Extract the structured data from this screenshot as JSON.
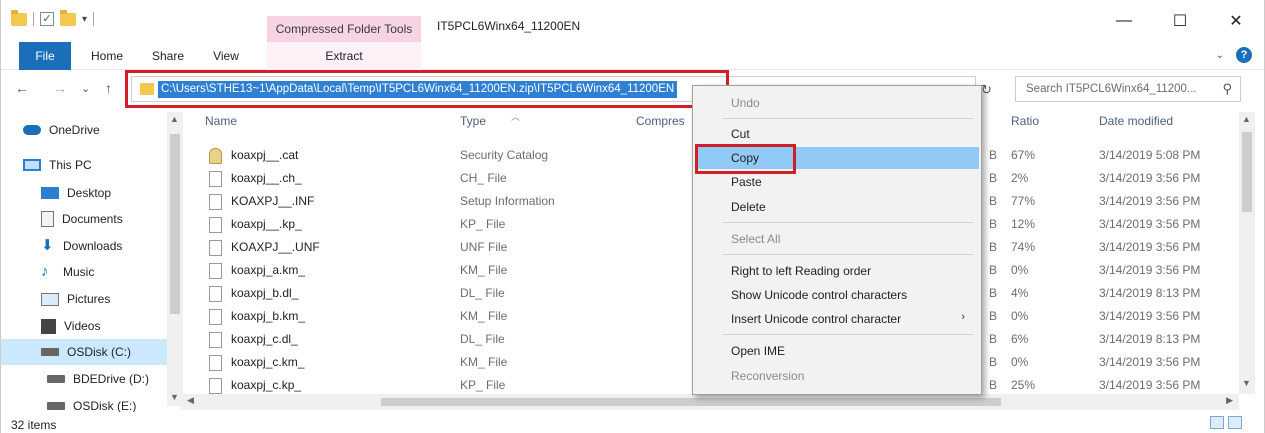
{
  "window": {
    "title": "IT5PCL6Winx64_11200EN",
    "context_tab_group": "Compressed Folder Tools",
    "controls": {
      "minimize": "—",
      "maximize": "☐",
      "close": "✕"
    }
  },
  "ribbon": {
    "tabs": [
      "File",
      "Home",
      "Share",
      "View",
      "Extract"
    ],
    "help_label": "?"
  },
  "address_bar": {
    "path": "C:\\Users\\STHE13~1\\AppData\\Local\\Temp\\IT5PCL6Winx64_11200EN.zip\\IT5PCL6Winx64_11200EN",
    "search_placeholder": "Search IT5PCL6Winx64_11200...",
    "nav": {
      "back": "←",
      "forward": "→",
      "recent": "⌄",
      "up": "↑",
      "refresh": "↻",
      "search": "⚲"
    }
  },
  "nav_pane": {
    "items": [
      {
        "label": "OneDrive",
        "icon": "onedrive-icon"
      },
      {
        "label": "This PC",
        "icon": "pc-icon"
      },
      {
        "label": "Desktop",
        "icon": "desktop-icon"
      },
      {
        "label": "Documents",
        "icon": "documents-icon"
      },
      {
        "label": "Downloads",
        "icon": "downloads-icon"
      },
      {
        "label": "Music",
        "icon": "music-icon"
      },
      {
        "label": "Pictures",
        "icon": "pictures-icon"
      },
      {
        "label": "Videos",
        "icon": "videos-icon"
      },
      {
        "label": "OSDisk (C:)",
        "icon": "drive-icon"
      },
      {
        "label": "BDEDrive (D:)",
        "icon": "drive-icon"
      },
      {
        "label": "OSDisk (E:)",
        "icon": "drive-icon"
      }
    ]
  },
  "columns": {
    "name": "Name",
    "type": "Type",
    "compressed": "Compres",
    "ratio": "Ratio",
    "date": "Date modified"
  },
  "files": [
    {
      "name": "koaxpj__.cat",
      "type": "Security Catalog",
      "ratio": "67%",
      "date": "3/14/2019 5:08 PM"
    },
    {
      "name": "koaxpj__.ch_",
      "type": "CH_ File",
      "ratio": "2%",
      "date": "3/14/2019 3:56 PM"
    },
    {
      "name": "KOAXPJ__.INF",
      "type": "Setup Information",
      "ratio": "77%",
      "date": "3/14/2019 3:56 PM"
    },
    {
      "name": "koaxpj__.kp_",
      "type": "KP_ File",
      "ratio": "12%",
      "date": "3/14/2019 3:56 PM"
    },
    {
      "name": "KOAXPJ__.UNF",
      "type": "UNF File",
      "ratio": "74%",
      "date": "3/14/2019 3:56 PM"
    },
    {
      "name": "koaxpj_a.km_",
      "type": "KM_ File",
      "ratio": "0%",
      "date": "3/14/2019 3:56 PM"
    },
    {
      "name": "koaxpj_b.dl_",
      "type": "DL_ File",
      "ratio": "4%",
      "date": "3/14/2019 8:13 PM"
    },
    {
      "name": "koaxpj_b.km_",
      "type": "KM_ File",
      "ratio": "0%",
      "date": "3/14/2019 3:56 PM"
    },
    {
      "name": "koaxpj_c.dl_",
      "type": "DL_ File",
      "ratio": "6%",
      "date": "3/14/2019 8:13 PM"
    },
    {
      "name": "koaxpj_c.km_",
      "type": "KM_ File",
      "ratio": "0%",
      "date": "3/14/2019 3:56 PM"
    },
    {
      "name": "koaxpj_c.kp_",
      "type": "KP_ File",
      "ratio": "25%",
      "date": "3/14/2019 3:56 PM"
    }
  ],
  "partial_size_fragment": "B",
  "context_menu": {
    "undo": "Undo",
    "cut": "Cut",
    "copy": "Copy",
    "paste": "Paste",
    "delete": "Delete",
    "select_all": "Select All",
    "rtl": "Right to left Reading order",
    "show_unicode": "Show Unicode control characters",
    "insert_unicode": "Insert Unicode control character",
    "submenu_arrow": "›",
    "open_ime": "Open IME",
    "reconversion": "Reconversion"
  },
  "status_bar": {
    "item_count": "32 items"
  },
  "colors": {
    "accent": "#1a6fb8",
    "highlight": "#d11f27",
    "selection": "#2f7fd3",
    "menu_hover": "#91c9f7"
  }
}
